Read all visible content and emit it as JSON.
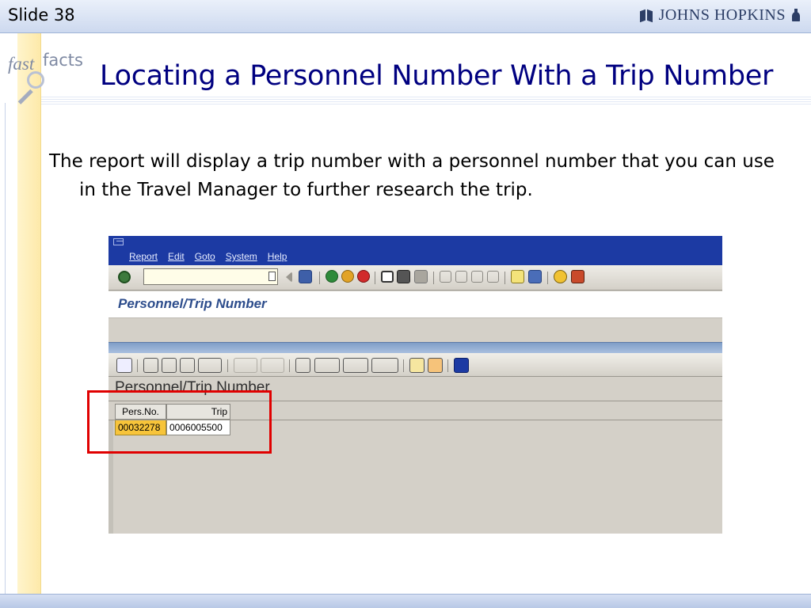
{
  "slide": {
    "label": "Slide 38",
    "brand": "JOHNS HOPKINS"
  },
  "logo": {
    "word1": "fast",
    "word2": "facts"
  },
  "title": "Locating a Personnel Number With a Trip Number",
  "body": "The report will display a trip number with a personnel number that you can use in the Travel Manager to further research the trip.",
  "sap": {
    "menu": [
      "Report",
      "Edit",
      "Goto",
      "System",
      "Help"
    ],
    "screen_title": "Personnel/Trip Number",
    "list_title": "Personnel/Trip Number",
    "columns": [
      "Pers.No.",
      "Trip"
    ],
    "rows": [
      {
        "pers_no": "00032278",
        "trip": "0006005500"
      }
    ]
  },
  "colors": {
    "title": "#000080",
    "sap_menubar": "#1c3aa3",
    "selected_cell": "#f7c43a",
    "highlight_box": "#e00000"
  }
}
